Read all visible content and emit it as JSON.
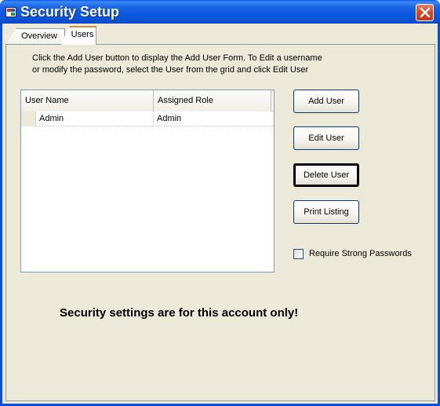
{
  "window": {
    "title": "Security Setup"
  },
  "tabs": [
    {
      "label": "Overview",
      "selected": false
    },
    {
      "label": "Users",
      "selected": true
    }
  ],
  "users_tab": {
    "instructions_line1": "Click the Add User button to display the Add User Form.  To Edit a username",
    "instructions_line2": "or modify the password, select the User from the grid and click Edit User",
    "grid": {
      "columns": [
        "User Name",
        "Assigned Role"
      ],
      "rows": [
        {
          "user_name": "Admin",
          "assigned_role": "Admin"
        }
      ]
    },
    "buttons": {
      "add": "Add User",
      "edit": "Edit User",
      "delete": "Delete User",
      "print": "Print Listing"
    },
    "require_strong_passwords": {
      "label": "Require Strong Passwords",
      "checked": false
    },
    "notice": "Security settings are for this account only!"
  },
  "colors": {
    "titlebar": "#0a5ee9",
    "close_button": "#d64a2a",
    "selected_tab_accent": "#e68b2c",
    "window_background": "#ece9d8"
  },
  "icons": {
    "app": "app-icon",
    "close": "close-icon"
  }
}
